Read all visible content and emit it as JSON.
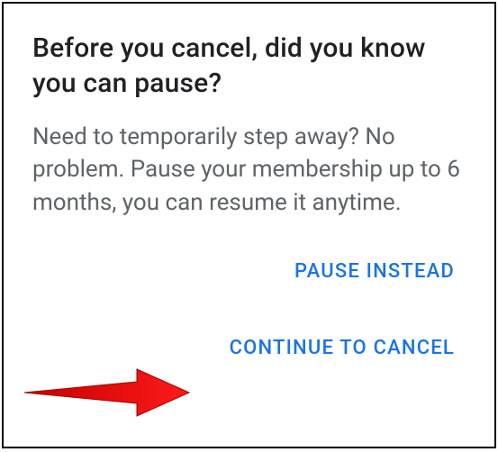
{
  "dialog": {
    "title": "Before you cancel, did you know you can pause?",
    "body": "Need to temporarily step away? No problem. Pause your membership up to 6 months, you can resume it anytime.",
    "actions": {
      "pause": "PAUSE INSTEAD",
      "continue": "CONTINUE TO CANCEL"
    }
  }
}
